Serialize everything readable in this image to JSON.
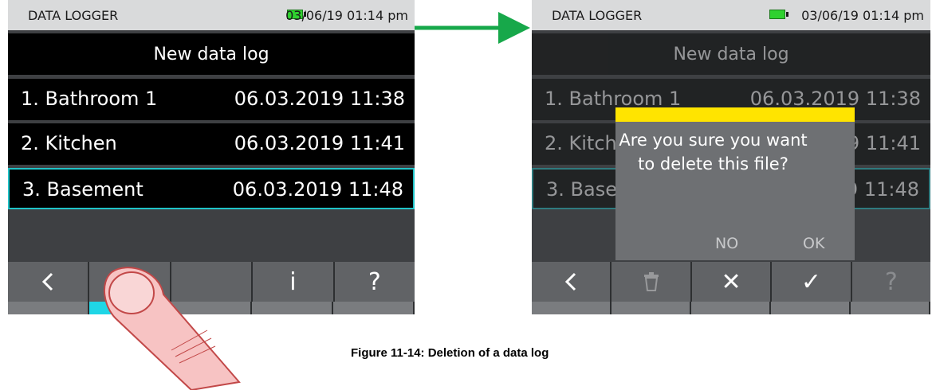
{
  "left": {
    "app_title": "DATA LOGGER",
    "datetime": "03/06/19 01:14 pm",
    "header": "New data log",
    "rows": [
      {
        "name": "1. Bathroom 1",
        "date": "06.03.2019 11:38"
      },
      {
        "name": "2. Kitchen",
        "date": "06.03.2019 11:41"
      },
      {
        "name": "3. Basement",
        "date": "06.03.2019 11:48"
      }
    ],
    "toolbar": {
      "back": "‹",
      "delete": "🗑",
      "info": "i",
      "help": "?"
    }
  },
  "right": {
    "app_title": "DATA LOGGER",
    "datetime": "03/06/19 01:14 pm",
    "header": "New data log",
    "rows": [
      {
        "name": "1. Bathroom 1",
        "date": "06.03.2019 11:38"
      },
      {
        "name": "2. Kitchen",
        "date": "06.03.2019 11:41"
      },
      {
        "name": "3. Basement",
        "date": "06.03.2019 11:48"
      }
    ],
    "dialog": {
      "message": "Are you sure you want to delete this file?",
      "no": "NO",
      "ok": "OK"
    },
    "toolbar": {
      "back": "‹",
      "delete": "🗑",
      "cancel": "✕",
      "confirm": "✓",
      "help": "?"
    }
  },
  "caption": "Figure 11-14: Deletion of a data log",
  "colors": {
    "selection": "#1fc3c8",
    "arrow": "#17a84a",
    "dialog_bar": "#ffe400",
    "battery": "#2fd12f"
  },
  "icons": [
    "battery-icon",
    "back-icon",
    "trash-icon",
    "info-icon",
    "help-icon",
    "close-icon",
    "check-icon",
    "finger-pointer",
    "right-arrow"
  ]
}
